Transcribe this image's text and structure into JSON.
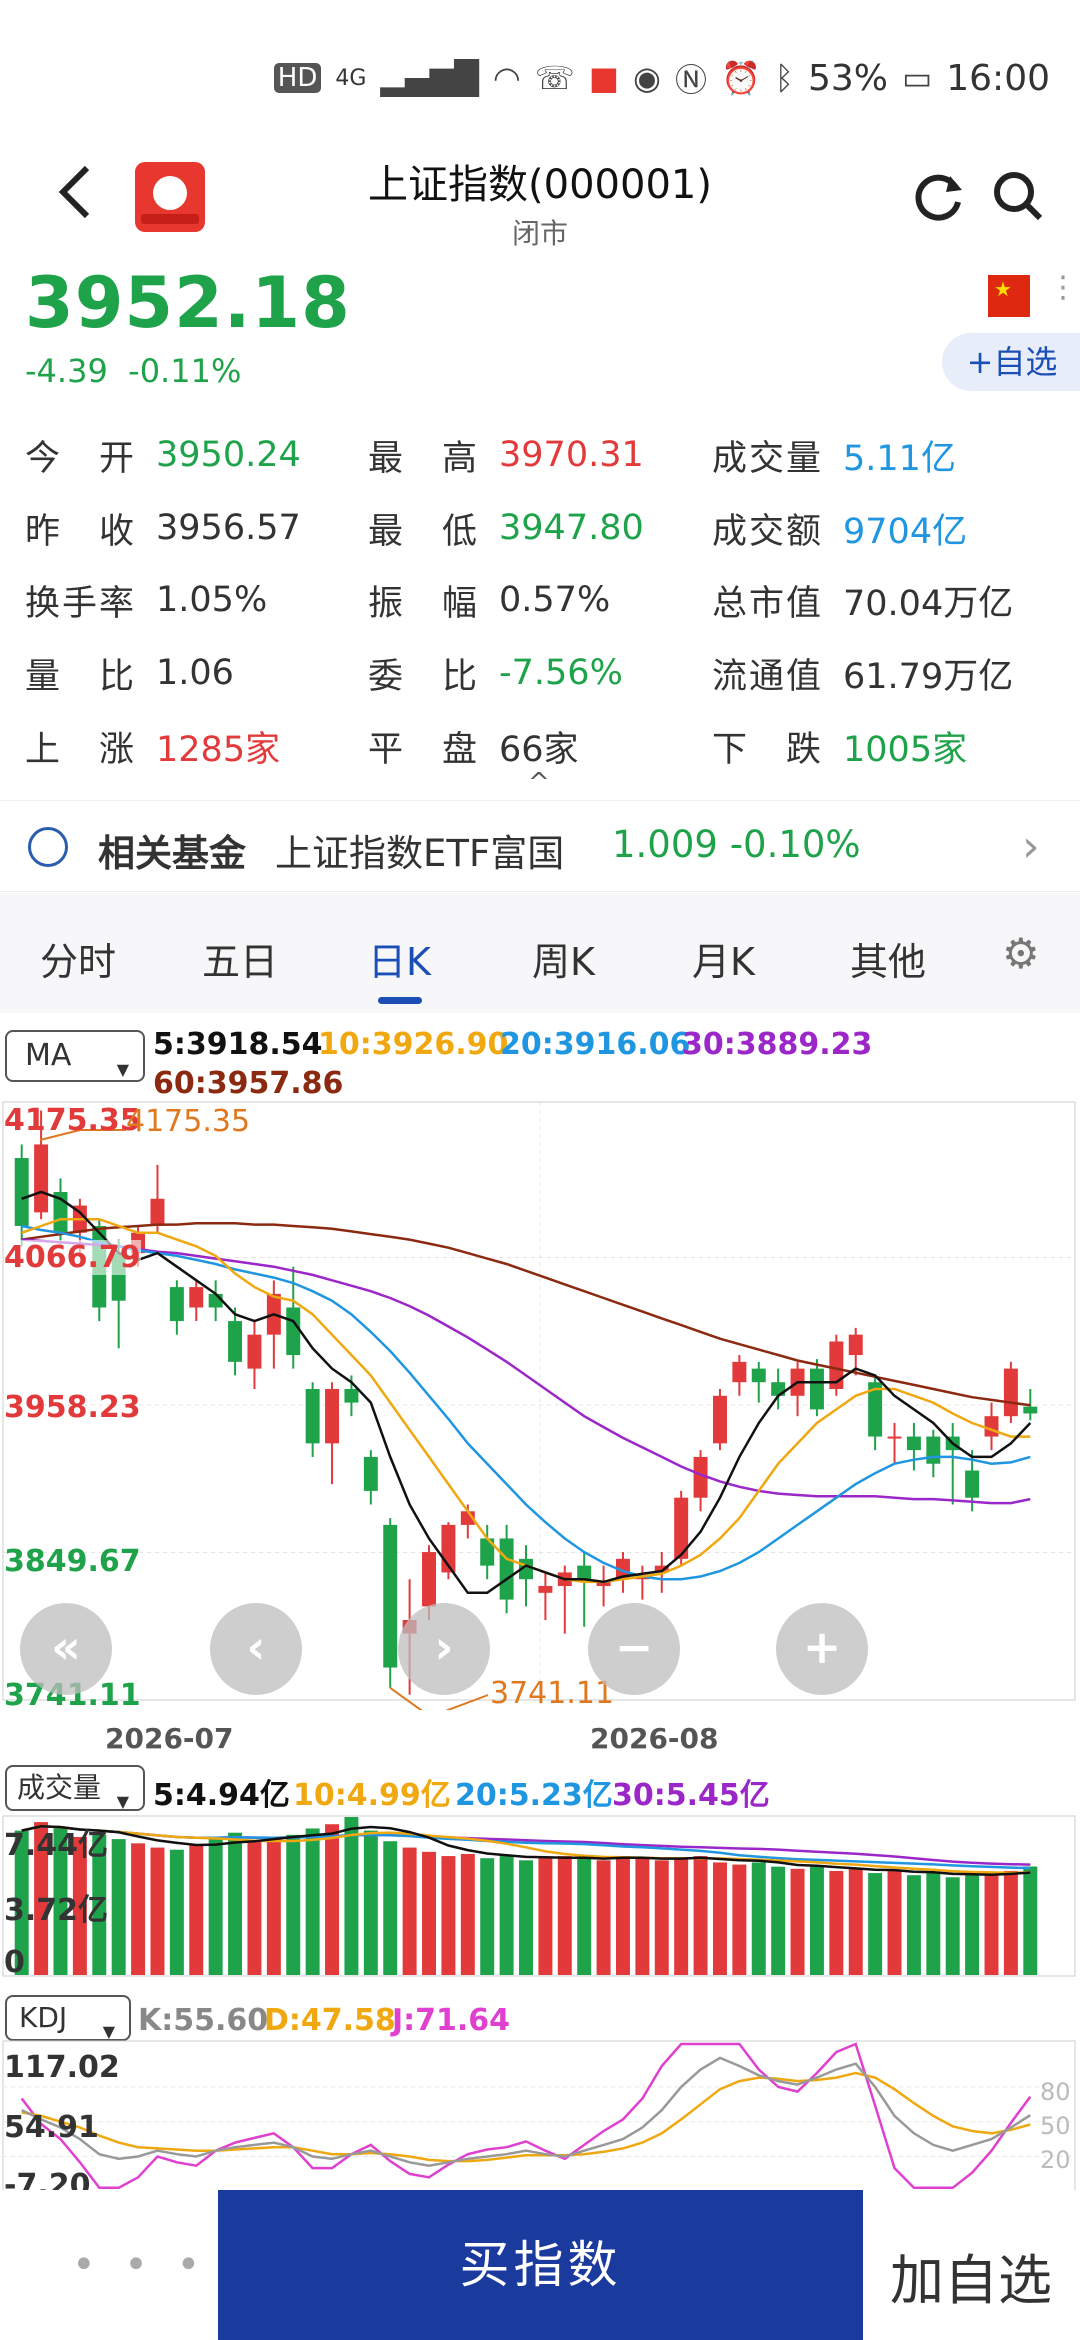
{
  "status_bar": {
    "hd": "HD",
    "network": "4G",
    "battery": "53%",
    "time": "16:00"
  },
  "header": {
    "title": "上证指数(000001)",
    "subtitle": "闭市"
  },
  "quote": {
    "price": "3952.18",
    "change": "-4.39",
    "change_pct": "-0.11%",
    "add_fav_label": "+自选"
  },
  "stats": [
    {
      "label": "今　开",
      "value": "3950.24"
    },
    {
      "label": "最　高",
      "value": "3970.31"
    },
    {
      "label": "成交量",
      "value": "5.11亿"
    },
    {
      "label": "昨　收",
      "value": "3956.57"
    },
    {
      "label": "最　低",
      "value": "3947.80"
    },
    {
      "label": "成交额",
      "value": "9704亿"
    },
    {
      "label": "换手率",
      "value": "1.05%"
    },
    {
      "label": "振　幅",
      "value": "0.57%"
    },
    {
      "label": "总市值",
      "value": "70.04万亿"
    },
    {
      "label": "量　比",
      "value": "1.06"
    },
    {
      "label": "委　比",
      "value": "-7.56%"
    },
    {
      "label": "流通值",
      "value": "61.79万亿"
    },
    {
      "label": "上　涨",
      "value": "1285家"
    },
    {
      "label": "平　盘",
      "value": "66家"
    },
    {
      "label": "下　跌",
      "value": "1005家"
    }
  ],
  "fund": {
    "title": "相关基金",
    "name": "上证指数ETF富国",
    "price": "1.009",
    "change": "-0.10%"
  },
  "tabs": [
    "分时",
    "五日",
    "日K",
    "周K",
    "月K",
    "其他"
  ],
  "active_tab": "日K",
  "ma": {
    "selector": "MA",
    "ma5": "5:3918.54",
    "ma10": "10:3926.90",
    "ma20": "20:3916.06",
    "ma30": "30:3889.23",
    "ma60": "60:3957.86"
  },
  "volume": {
    "selector": "成交量",
    "v5": "5:4.94亿",
    "v10": "10:4.99亿",
    "v20": "20:5.23亿",
    "v30": "30:5.45亿",
    "axis_top": "7.44亿",
    "axis_mid": "3.72亿",
    "axis_zero": "0"
  },
  "kdj": {
    "selector": "KDJ",
    "k": "K:55.60",
    "d": "D:47.58",
    "j": "J:71.64",
    "axis_top": "117.02",
    "axis_mid": "54.91",
    "axis_bottom": "-7.20",
    "levels": [
      "80",
      "50",
      "20"
    ]
  },
  "colors": {
    "up": "#e23a3a",
    "down": "#1ea34a",
    "ma5": "#111111",
    "ma10": "#f0a810",
    "ma20": "#2196e0",
    "ma30": "#9c27c8",
    "ma60": "#8b2a10",
    "brand": "#1a3a9e"
  },
  "chart_data": {
    "type": "candlestick",
    "y_ticks": [
      "4175.35",
      "4066.79",
      "3958.23",
      "3849.67",
      "3741.11"
    ],
    "ylim": [
      3741.11,
      4175.35
    ],
    "x_ticks": [
      "2026-07",
      "2026-08"
    ],
    "max_label": "4175.35",
    "min_label": "3741.11",
    "candles": [
      {
        "o": 4140,
        "c": 4090,
        "h": 4150,
        "l": 4075
      },
      {
        "o": 4100,
        "c": 4150,
        "h": 4175,
        "l": 4095
      },
      {
        "o": 4115,
        "c": 4085,
        "h": 4125,
        "l": 4075
      },
      {
        "o": 4085,
        "c": 4105,
        "h": 4110,
        "l": 4070
      },
      {
        "o": 4090,
        "c": 4030,
        "h": 4095,
        "l": 4020
      },
      {
        "o": 4070,
        "c": 4035,
        "h": 4080,
        "l": 4000
      },
      {
        "o": 4070,
        "c": 4085,
        "h": 4090,
        "l": 4060
      },
      {
        "o": 4090,
        "c": 4110,
        "h": 4135,
        "l": 4085
      },
      {
        "o": 4045,
        "c": 4020,
        "h": 4050,
        "l": 4010
      },
      {
        "o": 4030,
        "c": 4045,
        "h": 4050,
        "l": 4020
      },
      {
        "o": 4040,
        "c": 4030,
        "h": 4050,
        "l": 4020
      },
      {
        "o": 4020,
        "c": 3990,
        "h": 4030,
        "l": 3980
      },
      {
        "o": 3985,
        "c": 4010,
        "h": 4020,
        "l": 3970
      },
      {
        "o": 4010,
        "c": 4040,
        "h": 4050,
        "l": 3985
      },
      {
        "o": 4030,
        "c": 3995,
        "h": 4060,
        "l": 3985
      },
      {
        "o": 3970,
        "c": 3930,
        "h": 3975,
        "l": 3920
      },
      {
        "o": 3930,
        "c": 3970,
        "h": 3975,
        "l": 3900
      },
      {
        "o": 3970,
        "c": 3960,
        "h": 3980,
        "l": 3950
      },
      {
        "o": 3920,
        "c": 3895,
        "h": 3925,
        "l": 3885
      },
      {
        "o": 3870,
        "c": 3765,
        "h": 3875,
        "l": 3750
      },
      {
        "o": 3790,
        "c": 3800,
        "h": 3830,
        "l": 3745
      },
      {
        "o": 3810,
        "c": 3850,
        "h": 3855,
        "l": 3800
      },
      {
        "o": 3835,
        "c": 3870,
        "h": 3872,
        "l": 3830
      },
      {
        "o": 3870,
        "c": 3880,
        "h": 3885,
        "l": 3860
      },
      {
        "o": 3860,
        "c": 3840,
        "h": 3870,
        "l": 3830
      },
      {
        "o": 3860,
        "c": 3815,
        "h": 3870,
        "l": 3805
      },
      {
        "o": 3845,
        "c": 3830,
        "h": 3855,
        "l": 3810
      },
      {
        "o": 3820,
        "c": 3825,
        "h": 3835,
        "l": 3800
      },
      {
        "o": 3825,
        "c": 3835,
        "h": 3840,
        "l": 3790
      },
      {
        "o": 3840,
        "c": 3830,
        "h": 3850,
        "l": 3795
      },
      {
        "o": 3825,
        "c": 3828,
        "h": 3840,
        "l": 3810
      },
      {
        "o": 3830,
        "c": 3845,
        "h": 3850,
        "l": 3820
      },
      {
        "o": 3830,
        "c": 3832,
        "h": 3840,
        "l": 3815
      },
      {
        "o": 3835,
        "c": 3840,
        "h": 3850,
        "l": 3820
      },
      {
        "o": 3845,
        "c": 3890,
        "h": 3895,
        "l": 3840
      },
      {
        "o": 3890,
        "c": 3920,
        "h": 3925,
        "l": 3880
      },
      {
        "o": 3930,
        "c": 3965,
        "h": 3970,
        "l": 3925
      },
      {
        "o": 3975,
        "c": 3990,
        "h": 3995,
        "l": 3965
      },
      {
        "o": 3985,
        "c": 3975,
        "h": 3990,
        "l": 3960
      },
      {
        "o": 3975,
        "c": 3965,
        "h": 3985,
        "l": 3955
      },
      {
        "o": 3965,
        "c": 3985,
        "h": 3990,
        "l": 3950
      },
      {
        "o": 3985,
        "c": 3955,
        "h": 3992,
        "l": 3950
      },
      {
        "o": 3970,
        "c": 4005,
        "h": 4010,
        "l": 3965
      },
      {
        "o": 3995,
        "c": 4010,
        "h": 4015,
        "l": 3980
      },
      {
        "o": 3975,
        "c": 3935,
        "h": 3980,
        "l": 3925
      },
      {
        "o": 3935,
        "c": 3935,
        "h": 3945,
        "l": 3915
      },
      {
        "o": 3935,
        "c": 3925,
        "h": 3945,
        "l": 3910
      },
      {
        "o": 3935,
        "c": 3915,
        "h": 3940,
        "l": 3905
      },
      {
        "o": 3935,
        "c": 3925,
        "h": 3945,
        "l": 3885
      },
      {
        "o": 3910,
        "c": 3890,
        "h": 3925,
        "l": 3880
      },
      {
        "o": 3935,
        "c": 3950,
        "h": 3960,
        "l": 3925
      },
      {
        "o": 3950,
        "c": 3985,
        "h": 3990,
        "l": 3945
      },
      {
        "o": 3957,
        "c": 3952,
        "h": 3970,
        "l": 3947
      }
    ],
    "ma5": [
      4110,
      4115,
      4110,
      4100,
      4085,
      4070,
      4065,
      4070,
      4060,
      4050,
      4040,
      4025,
      4020,
      4025,
      4020,
      4000,
      3985,
      3975,
      3960,
      3920,
      3885,
      3860,
      3840,
      3820,
      3820,
      3830,
      3840,
      3835,
      3830,
      3830,
      3828,
      3832,
      3834,
      3836,
      3848,
      3865,
      3890,
      3920,
      3945,
      3965,
      3975,
      3975,
      3975,
      3985,
      3980,
      3965,
      3955,
      3945,
      3930,
      3920,
      3920,
      3930,
      3945
    ],
    "ma10": [
      4085,
      4090,
      4095,
      4095,
      4095,
      4090,
      4085,
      4085,
      4080,
      4075,
      4068,
      4055,
      4045,
      4038,
      4035,
      4025,
      4010,
      3995,
      3980,
      3960,
      3940,
      3920,
      3900,
      3880,
      3860,
      3845,
      3840,
      3835,
      3830,
      3828,
      3828,
      3830,
      3832,
      3834,
      3840,
      3848,
      3860,
      3875,
      3895,
      3915,
      3930,
      3945,
      3955,
      3965,
      3970,
      3970,
      3965,
      3960,
      3952,
      3945,
      3940,
      3935,
      3935
    ],
    "ma20": [
      4090,
      4087,
      4085,
      4082,
      4078,
      4075,
      4072,
      4070,
      4068,
      4065,
      4062,
      4058,
      4055,
      4052,
      4048,
      4042,
      4035,
      4025,
      4012,
      3998,
      3982,
      3965,
      3948,
      3930,
      3915,
      3900,
      3885,
      3872,
      3860,
      3850,
      3842,
      3836,
      3832,
      3830,
      3830,
      3832,
      3836,
      3842,
      3850,
      3860,
      3870,
      3880,
      3890,
      3900,
      3908,
      3915,
      3918,
      3920,
      3920,
      3918,
      3915,
      3916,
      3920
    ],
    "ma30": [
      4080,
      4079,
      4078,
      4077,
      4076,
      4075,
      4073,
      4071,
      4070,
      4068,
      4066,
      4064,
      4062,
      4060,
      4057,
      4054,
      4050,
      4046,
      4042,
      4037,
      4031,
      4024,
      4016,
      4008,
      3999,
      3990,
      3980,
      3970,
      3960,
      3950,
      3942,
      3934,
      3927,
      3920,
      3913,
      3907,
      3902,
      3898,
      3895,
      3893,
      3892,
      3891,
      3891,
      3891,
      3891,
      3890,
      3889,
      3889,
      3888,
      3887,
      3886,
      3886,
      3889
    ],
    "ma60": [
      4080,
      4082,
      4084,
      4086,
      4088,
      4089,
      4090,
      4091,
      4091,
      4092,
      4092,
      4092,
      4091,
      4091,
      4090,
      4089,
      4088,
      4086,
      4084,
      4082,
      4080,
      4077,
      4074,
      4070,
      4066,
      4062,
      4057,
      4052,
      4047,
      4042,
      4037,
      4032,
      4027,
      4022,
      4017,
      4012,
      4007,
      4003,
      3999,
      3995,
      3991,
      3988,
      3985,
      3982,
      3979,
      3976,
      3973,
      3970,
      3967,
      3964,
      3962,
      3960,
      3958
    ],
    "volumes": [
      6.8,
      7.2,
      6.9,
      6.5,
      6.6,
      6.4,
      6.2,
      6.0,
      5.9,
      6.1,
      6.5,
      6.7,
      6.3,
      6.4,
      6.6,
      6.9,
      7.1,
      7.44,
      6.8,
      6.3,
      6.0,
      5.8,
      5.6,
      5.7,
      5.5,
      5.6,
      5.4,
      5.5,
      5.6,
      5.5,
      5.4,
      5.6,
      5.5,
      5.4,
      5.5,
      5.6,
      5.3,
      5.2,
      5.3,
      5.1,
      5.0,
      5.1,
      4.9,
      5.0,
      4.8,
      4.9,
      4.7,
      4.8,
      4.6,
      4.7,
      4.8,
      4.9,
      5.11
    ],
    "vol_ylim": [
      0,
      7.44
    ],
    "kdj_k": [
      60,
      52,
      45,
      35,
      22,
      18,
      20,
      25,
      22,
      20,
      25,
      28,
      30,
      32,
      28,
      20,
      18,
      22,
      25,
      20,
      15,
      12,
      15,
      18,
      20,
      22,
      25,
      22,
      20,
      25,
      30,
      35,
      45,
      60,
      80,
      95,
      105,
      98,
      90,
      85,
      82,
      88,
      95,
      100,
      80,
      55,
      40,
      30,
      25,
      30,
      35,
      45,
      55.6
    ],
    "kdj_d": [
      58,
      55,
      50,
      45,
      38,
      32,
      28,
      27,
      26,
      25,
      25,
      26,
      27,
      28,
      28,
      25,
      22,
      22,
      23,
      22,
      20,
      17,
      16,
      16,
      17,
      19,
      21,
      21,
      21,
      22,
      24,
      27,
      32,
      40,
      52,
      65,
      78,
      85,
      88,
      87,
      85,
      86,
      88,
      92,
      88,
      78,
      66,
      55,
      46,
      42,
      40,
      43,
      47.58
    ],
    "kdj_j": [
      70,
      48,
      35,
      15,
      -7,
      -7,
      2,
      20,
      15,
      12,
      25,
      32,
      36,
      40,
      28,
      10,
      10,
      22,
      30,
      16,
      5,
      2,
      13,
      22,
      26,
      28,
      33,
      25,
      18,
      30,
      42,
      52,
      70,
      98,
      117,
      117,
      117,
      117,
      95,
      80,
      76,
      92,
      110,
      117,
      64,
      10,
      -7,
      -7,
      -7,
      6,
      25,
      49,
      71.64
    ],
    "kdj_ylim": [
      -7.2,
      117.02
    ]
  },
  "bottom": {
    "more_label": "• • •",
    "buy_label": "买指数",
    "addfav_label": "加自选"
  }
}
